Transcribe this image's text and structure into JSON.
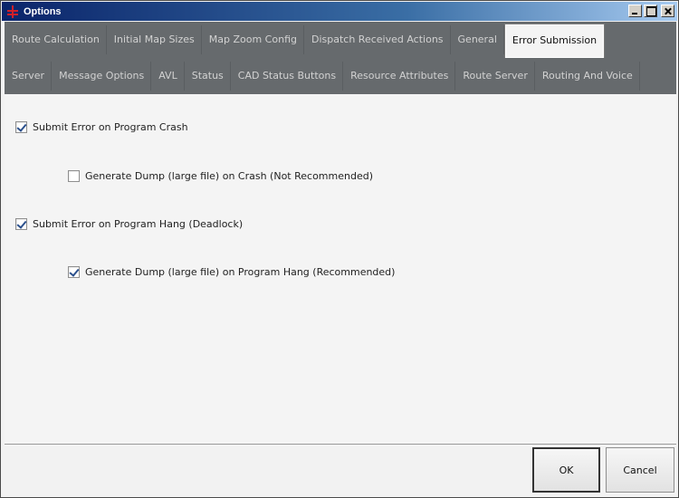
{
  "window": {
    "title": "Options",
    "controls": {
      "minimize": "minimize-icon",
      "maximize": "maximize-icon",
      "close": "close-icon"
    }
  },
  "tabs_row1": [
    {
      "label": "Route Calculation",
      "active": false
    },
    {
      "label": "Initial Map Sizes",
      "active": false
    },
    {
      "label": "Map Zoom Config",
      "active": false
    },
    {
      "label": "Dispatch Received Actions",
      "active": false
    },
    {
      "label": "General",
      "active": false
    },
    {
      "label": "Error Submission",
      "active": true
    }
  ],
  "tabs_row2": [
    {
      "label": "Server"
    },
    {
      "label": "Message Options"
    },
    {
      "label": "AVL"
    },
    {
      "label": "Status"
    },
    {
      "label": "CAD Status Buttons"
    },
    {
      "label": "Resource Attributes"
    },
    {
      "label": "Route Server"
    },
    {
      "label": "Routing And Voice"
    }
  ],
  "settings": {
    "submit_crash": {
      "label": "Submit Error on Program Crash",
      "checked": true
    },
    "dump_crash": {
      "label": "Generate Dump (large file) on Crash (Not Recommended)",
      "checked": false
    },
    "submit_hang": {
      "label": "Submit Error on Program Hang (Deadlock)",
      "checked": true
    },
    "dump_hang": {
      "label": "Generate Dump (large file) on Program Hang (Recommended)",
      "checked": true
    }
  },
  "footer": {
    "ok_label": "OK",
    "cancel_label": "Cancel"
  },
  "colors": {
    "tab_strip": "#666a6d",
    "title_bar": "#0a246a",
    "check_mark": "#2a4f8c"
  }
}
